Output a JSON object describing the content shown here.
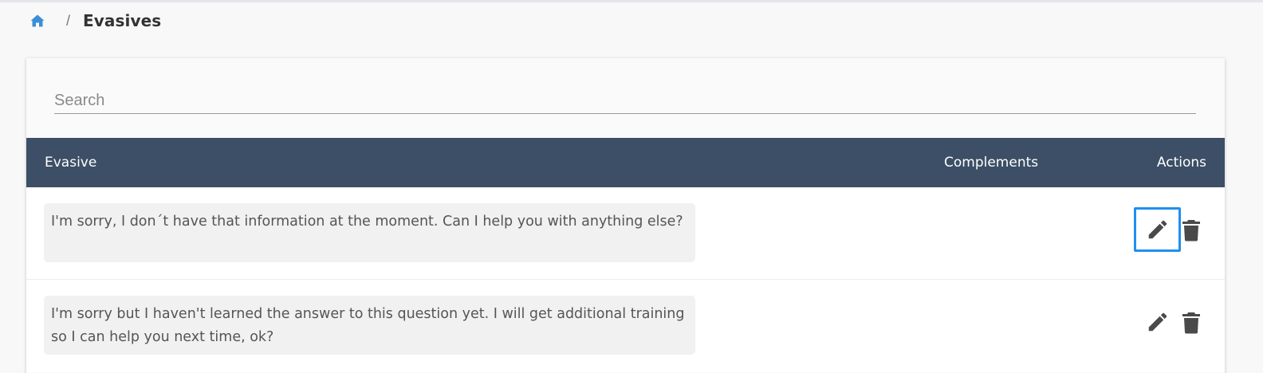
{
  "breadcrumb": {
    "home_icon": "home-icon",
    "separator": "/",
    "current": "Evasives"
  },
  "search": {
    "placeholder": "Search",
    "value": ""
  },
  "table": {
    "columns": [
      "Evasive",
      "Complements",
      "Actions"
    ],
    "rows": [
      {
        "evasive": "I'm sorry, I don´t have that information at the moment. Can I help you with anything else?",
        "complements": "",
        "actions": [
          "pencil-icon",
          "trash-icon"
        ],
        "edit_focused": true
      },
      {
        "evasive": "I'm sorry but I haven't learned the answer to this question yet. I will get additional training so I can help you next time, ok?",
        "complements": "",
        "actions": [
          "pencil-icon",
          "trash-icon"
        ],
        "edit_focused": false
      }
    ]
  },
  "colors": {
    "header_bg": "#3c4f66",
    "accent_home": "#3a8fd6",
    "focus_ring": "#1e90f0",
    "icon": "#4a4a4a",
    "bubble_bg": "#f1f1f1"
  }
}
